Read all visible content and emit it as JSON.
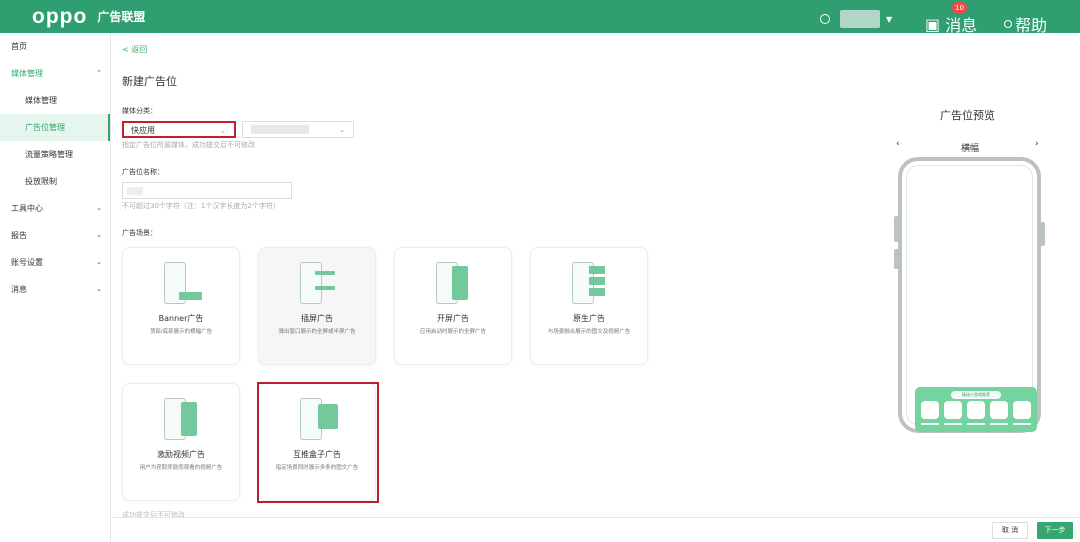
{
  "topbar": {
    "logo_text": "oppo",
    "brand": "广告联盟",
    "messages_label": "消息",
    "message_count": "10",
    "help_label": "帮助"
  },
  "sidebar": {
    "items": [
      {
        "label": "首页"
      },
      {
        "label": "媒体管理"
      },
      {
        "label": "媒体管理"
      },
      {
        "label": "广告位管理"
      },
      {
        "label": "流量策略管理"
      },
      {
        "label": "投放限制"
      },
      {
        "label": "工具中心"
      },
      {
        "label": "报告"
      },
      {
        "label": "账号设置"
      },
      {
        "label": "消息"
      }
    ]
  },
  "main": {
    "back": "< 返回",
    "title": "新建广告位",
    "media_category_label": "媒体分类：",
    "media_category_value": "快应用",
    "media_category_hint": "指定广告位所属媒体，成功提交后不可修改",
    "ad_slot_name_label": "广告位名称：",
    "ad_slot_name_hint": "不可超过30个字符（注：1个汉字长度为2个字符）",
    "ad_scene_label": "广告场景："
  },
  "cards": [
    {
      "title": "Banner广告",
      "desc": "顶部/底部展示的横幅广告"
    },
    {
      "title": "插屏广告",
      "desc": "弹出窗口展示的全屏或半屏广告"
    },
    {
      "title": "开屏广告",
      "desc": "应用启动时展示的全屏广告"
    },
    {
      "title": "原生广告",
      "desc": "与场景融合展示的图文及视频广告"
    },
    {
      "title": "激励视频广告",
      "desc": "用户为获取奖励而观看的视频广告"
    },
    {
      "title": "互推盒子广告",
      "desc": "指定场景同时展示多条的图文广告"
    }
  ],
  "preview": {
    "title": "广告位预览",
    "current_type": "横幅",
    "panel_label": "精选小游戏推荐"
  },
  "footer": {
    "note": "成功提交后不可修改",
    "cancel": "取 消",
    "next": "下一步"
  }
}
